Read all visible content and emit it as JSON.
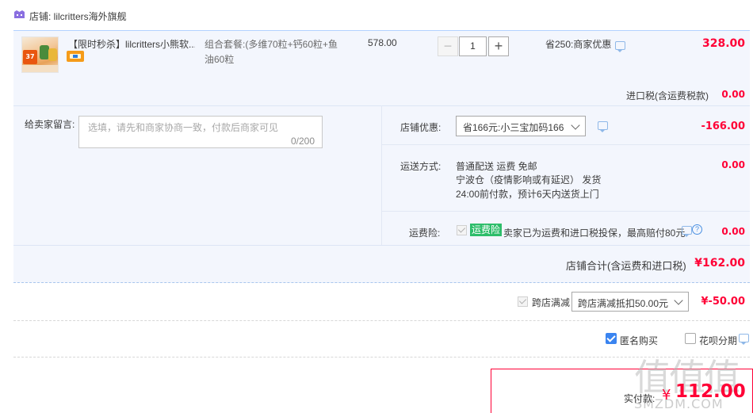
{
  "shop": {
    "label": "店铺: lilcritters海外旗舰"
  },
  "item": {
    "title": "【限时秒杀】lilcritters小熊软...",
    "thumb_badge": "37",
    "combo": "组合套餐:(多维70粒+钙60粒+鱼油60粒",
    "unit_price": "578.00",
    "qty_minus": "−",
    "qty": "1",
    "qty_plus": "+",
    "discount": "省250:商家优惠",
    "total": "328.00"
  },
  "tax": {
    "label": "进口税(含运费税款)",
    "value": "0.00"
  },
  "message": {
    "label": "给卖家留言:",
    "placeholder": "选填，请先和商家协商一致，付款后商家可见",
    "counter": "0/200"
  },
  "shop_discount": {
    "label": "店铺优惠:",
    "selected": "省166元:小三宝加码166",
    "value": "-166.00"
  },
  "shipping": {
    "label": "运送方式:",
    "line1": "普通配送 运费 免邮",
    "line2": "宁波仓（疫情影响或有延迟）  发货",
    "line3": "24:00前付款，预计6天内送货上门",
    "value": "0.00"
  },
  "insurance": {
    "label": "运费险:",
    "tag": "运费险",
    "text": "卖家已为运费和进口税投保，最高赔付80元",
    "value": "0.00"
  },
  "subtotal": {
    "label": "店铺合计(含运费和进口税)",
    "value": "¥162.00"
  },
  "cross_shop": {
    "label": "跨店满减",
    "selected": "跨店满减抵扣50.00元",
    "value": "¥-50.00"
  },
  "options": {
    "anonymous_label": "匿名购买",
    "anonymous_checked": true,
    "huabei_label": "花呗分期",
    "huabei_checked": false
  },
  "payment": {
    "label": "实付款:",
    "currency": "¥",
    "value": "112.00"
  },
  "watermark": {
    "glyphs": "值值值",
    "text": "SMZDM.COM"
  },
  "colors": {
    "accent_red": "#ff0036",
    "row_bg": "#f3f6fd",
    "check_blue": "#3a84f0",
    "insurance_green": "#2dbd6a"
  }
}
